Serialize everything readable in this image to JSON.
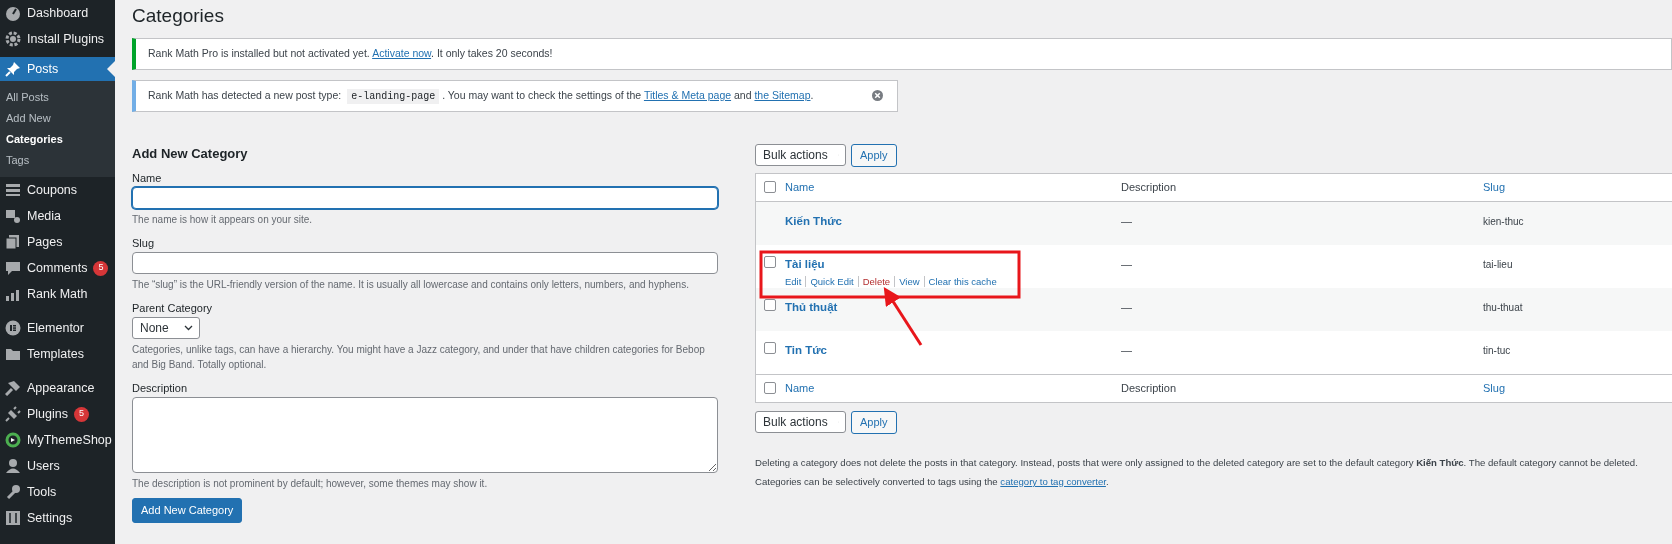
{
  "sidebar": {
    "items": [
      {
        "label": "Dashboard",
        "selected": false
      },
      {
        "label": "Install Plugins",
        "selected": false
      },
      {
        "label": "Posts",
        "selected": true,
        "children": [
          {
            "label": "All Posts",
            "selected": false
          },
          {
            "label": "Add New",
            "selected": false
          },
          {
            "label": "Categories",
            "selected": true
          },
          {
            "label": "Tags",
            "selected": false
          }
        ]
      },
      {
        "label": "Coupons",
        "selected": false
      },
      {
        "label": "Media",
        "selected": false
      },
      {
        "label": "Pages",
        "selected": false
      },
      {
        "label": "Comments",
        "selected": false,
        "badge": "5"
      },
      {
        "label": "Rank Math",
        "selected": false
      },
      {
        "label": "Elementor",
        "selected": false,
        "separator_before": true
      },
      {
        "label": "Templates",
        "selected": false
      },
      {
        "label": "Appearance",
        "selected": false,
        "separator_before": true
      },
      {
        "label": "Plugins",
        "selected": false,
        "badge": "5"
      },
      {
        "label": "MyThemeShop",
        "selected": false
      },
      {
        "label": "Users",
        "selected": false
      },
      {
        "label": "Tools",
        "selected": false
      },
      {
        "label": "Settings",
        "selected": false
      }
    ]
  },
  "page_title": "Categories",
  "notices": [
    {
      "kind": "success",
      "dismissible": false,
      "parts": [
        {
          "kind": "text",
          "text": "Rank Math Pro is installed but not activated yet. "
        },
        {
          "kind": "link",
          "text": "Activate now"
        },
        {
          "kind": "text",
          "text": ". It only takes 20 seconds!"
        }
      ]
    },
    {
      "kind": "info",
      "dismissible": true,
      "parts": [
        {
          "kind": "text",
          "text": "Rank Math has detected a new post type: "
        },
        {
          "kind": "code",
          "text": "e-landing-page"
        },
        {
          "kind": "text",
          "text": ". You may want to check the settings of the "
        },
        {
          "kind": "link",
          "text": "Titles & Meta page"
        },
        {
          "kind": "text",
          "text": " and "
        },
        {
          "kind": "link",
          "text": "the Sitemap"
        },
        {
          "kind": "text",
          "text": "."
        }
      ]
    }
  ],
  "form": {
    "title": "Add New Category",
    "fields": [
      {
        "kind": "text",
        "label": "Name",
        "focused": true,
        "help": "The name is how it appears on your site."
      },
      {
        "kind": "text",
        "label": "Slug",
        "focused": false,
        "help": "The “slug” is the URL-friendly version of the name. It is usually all lowercase and contains only letters, numbers, and hyphens."
      },
      {
        "kind": "select",
        "label": "Parent Category",
        "value": "None",
        "help": "Categories, unlike tags, can have a hierarchy. You might have a Jazz category, and under that have children categories for Bebop and Big Band. Totally optional."
      },
      {
        "kind": "textarea",
        "label": "Description",
        "focused": false,
        "help": "The description is not prominent by default; however, some themes may show it."
      }
    ],
    "submit": "Add New Category"
  },
  "bulk_top": {
    "select": "Bulk actions",
    "button": "Apply"
  },
  "table": {
    "header_checked": false,
    "footer_checked": false,
    "columns": [
      "Name",
      "Description",
      "Slug"
    ],
    "rows": [
      {
        "name": "Kiến Thức",
        "description": "—",
        "slug": "kien-thuc",
        "kind": "default"
      },
      {
        "name": "Tài liệu",
        "description": "—",
        "slug": "tai-lieu",
        "kind": "normal",
        "checked": false,
        "actions": [
          {
            "label": "Edit",
            "kind": "link"
          },
          {
            "label": "Quick Edit",
            "kind": "link"
          },
          {
            "label": "Delete",
            "kind": "delete"
          },
          {
            "label": "View",
            "kind": "link"
          },
          {
            "label": "Clear this cache",
            "kind": "link"
          }
        ]
      },
      {
        "name": "Thủ thuật",
        "description": "—",
        "slug": "thu-thuat",
        "kind": "normal",
        "checked": false
      },
      {
        "name": "Tin Tức",
        "description": "—",
        "slug": "tin-tuc",
        "kind": "normal",
        "checked": false
      }
    ],
    "footer_columns": [
      "Name",
      "Description",
      "Slug"
    ]
  },
  "bulk_bottom": {
    "select": "Bulk actions",
    "button": "Apply"
  },
  "notes": [
    {
      "text": "Deleting a category does not delete the posts in that category. Instead, posts that were only assigned to the deleted category are set to the default category **Kiến Thức**. The default category cannot be deleted."
    },
    {
      "text": "Categories can be selectively converted to tags using the ",
      "link": "category to tag converter",
      "after": "."
    }
  ]
}
